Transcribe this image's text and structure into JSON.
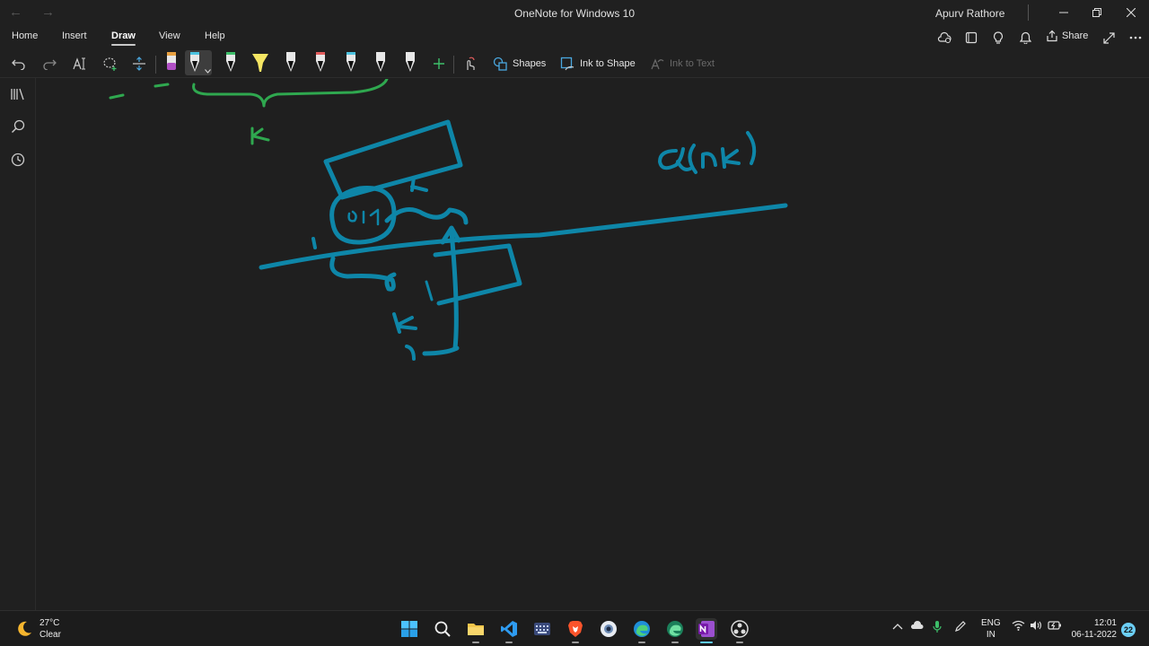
{
  "window": {
    "title": "OneNote for Windows 10",
    "user": "Apurv Rathore",
    "back_glyph": "←",
    "forward_glyph": "→"
  },
  "tabs": [
    {
      "label": "Home"
    },
    {
      "label": "Insert"
    },
    {
      "label": "Draw",
      "active": true
    },
    {
      "label": "View"
    },
    {
      "label": "Help"
    }
  ],
  "header_actions": {
    "share_label": "Share"
  },
  "toolbar": {
    "shapes_label": "Shapes",
    "ink_to_shape_label": "Ink to Shape",
    "ink_to_text_label": "Ink to Text",
    "pens": [
      {
        "name": "pen-purple",
        "body": "#2b2b2b",
        "tip": "#b04fc4",
        "band": "#e8a040"
      },
      {
        "name": "pen-black-selected",
        "body": "#e8e8e8",
        "tip": "#111111",
        "band": "#4cc3e0"
      },
      {
        "name": "pen-green",
        "body": "#e8e8e8",
        "tip": "#111111",
        "band": "#3dbf6a"
      },
      {
        "name": "highlighter-yellow",
        "body": "#f5e663",
        "tip": "#f5e663",
        "band": "#f5e663"
      },
      {
        "name": "pen-white-1",
        "body": "#e8e8e8",
        "tip": "#111111",
        "band": "#e8e8e8"
      },
      {
        "name": "pen-rainbow",
        "body": "#e8e8e8",
        "tip": "#111111",
        "band": "#e25c5c"
      },
      {
        "name": "pen-blue",
        "body": "#e8e8e8",
        "tip": "#111111",
        "band": "#4cc3e0"
      },
      {
        "name": "pen-white-2",
        "body": "#e8e8e8",
        "tip": "#111111",
        "band": "#e8e8e8"
      },
      {
        "name": "pen-white-3",
        "body": "#e8e8e8",
        "tip": "#111111",
        "band": "#e8e8e8"
      }
    ]
  },
  "colors": {
    "ink_green": "#2fa84f",
    "ink_teal": "#0e86a8",
    "accent": "#60cdff"
  },
  "taskbar": {
    "weather_temp": "27°C",
    "weather_desc": "Clear",
    "lang_top": "ENG",
    "lang_bottom": "IN",
    "time": "12:01",
    "date": "06-11-2022",
    "notification_count": "22"
  }
}
